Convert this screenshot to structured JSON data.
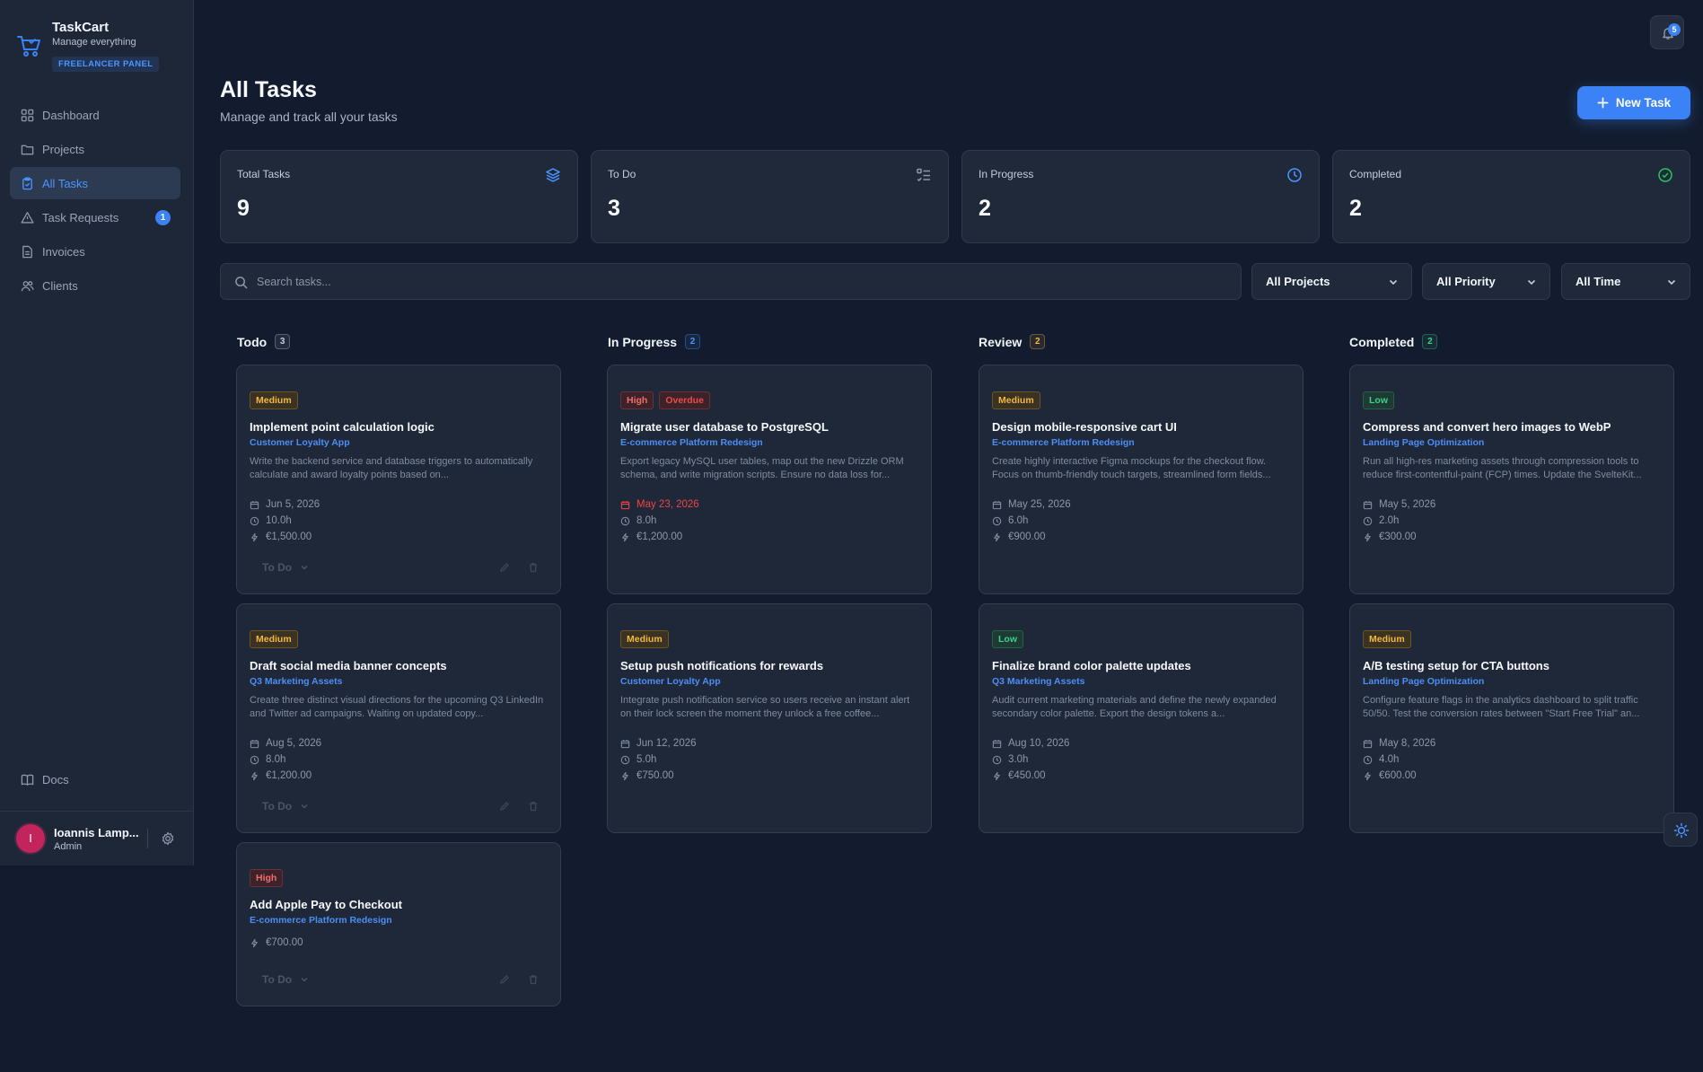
{
  "brand": {
    "name": "TaskCart",
    "tagline": "Manage everything",
    "panel": "FREELANCER PANEL"
  },
  "nav": {
    "items": [
      {
        "label": "Dashboard",
        "icon": "grid-icon"
      },
      {
        "label": "Projects",
        "icon": "folder-icon"
      },
      {
        "label": "All Tasks",
        "icon": "clipboard-icon",
        "active": true
      },
      {
        "label": "Task Requests",
        "icon": "alert-triangle-icon",
        "badge": "1"
      },
      {
        "label": "Invoices",
        "icon": "file-icon"
      },
      {
        "label": "Clients",
        "icon": "users-icon"
      }
    ],
    "docs": "Docs"
  },
  "user": {
    "name": "Ioannis Lamp...",
    "role": "Admin",
    "initial": "I"
  },
  "notifications": {
    "count": "5"
  },
  "header": {
    "title": "All Tasks",
    "subtitle": "Manage and track all your tasks",
    "new_task": "New Task"
  },
  "stats": [
    {
      "label": "Total Tasks",
      "value": "9",
      "icon": "layers-icon",
      "color": "#4d95ff"
    },
    {
      "label": "To Do",
      "value": "3",
      "icon": "list-todo-icon",
      "color": "#8c97aa"
    },
    {
      "label": "In Progress",
      "value": "2",
      "icon": "clock-icon",
      "color": "#4d95ff"
    },
    {
      "label": "Completed",
      "value": "2",
      "icon": "check-circle-icon",
      "color": "#22c55e"
    }
  ],
  "filters": {
    "search_placeholder": "Search tasks...",
    "projects": "All Projects",
    "priority": "All Priority",
    "time": "All Time"
  },
  "columns": [
    {
      "title": "Todo",
      "count": "3",
      "accent": "#c3ccd9"
    },
    {
      "title": "In Progress",
      "count": "2",
      "accent": "#4d95ff"
    },
    {
      "title": "Review",
      "count": "2",
      "accent": "#f5b83d"
    },
    {
      "title": "Completed",
      "count": "2",
      "accent": "#3ecf8e"
    }
  ],
  "cards": [
    {
      "col": 0,
      "row": 0,
      "priority": "Medium",
      "title": "Implement point calculation logic",
      "project": "Customer Loyalty App",
      "desc": "Write the backend service and database triggers to automatically calculate and award loyalty points based on...",
      "date": "Jun 5, 2026",
      "hours": "10.0h",
      "amount": "€1,500.00",
      "status": "To Do"
    },
    {
      "col": 0,
      "row": 1,
      "priority": "Medium",
      "title": "Draft social media banner concepts",
      "project": "Q3 Marketing Assets",
      "desc": "Create three distinct visual directions for the upcoming Q3 LinkedIn and Twitter ad campaigns. Waiting on updated copy...",
      "date": "Aug 5, 2026",
      "hours": "8.0h",
      "amount": "€1,200.00",
      "status": "To Do"
    },
    {
      "col": 0,
      "row": 2,
      "priority": "High",
      "title": "Add Apple Pay to Checkout",
      "project": "E-commerce Platform Redesign",
      "amount": "€700.00",
      "status": "To Do"
    },
    {
      "col": 1,
      "row": 0,
      "priority": "High",
      "overdue": "Overdue",
      "title": "Migrate user database to PostgreSQL",
      "project": "E-commerce Platform Redesign",
      "desc": "Export legacy MySQL user tables, map out the new Drizzle ORM schema, and write migration scripts. Ensure no data loss for...",
      "date": "May 23, 2026",
      "date_overdue": true,
      "hours": "8.0h",
      "amount": "€1,200.00"
    },
    {
      "col": 1,
      "row": 1,
      "priority": "Medium",
      "title": "Setup push notifications for rewards",
      "project": "Customer Loyalty App",
      "desc": "Integrate push notification service so users receive an instant alert on their lock screen the moment they unlock a free coffee...",
      "date": "Jun 12, 2026",
      "hours": "5.0h",
      "amount": "€750.00"
    },
    {
      "col": 2,
      "row": 0,
      "priority": "Medium",
      "title": "Design mobile-responsive cart UI",
      "project": "E-commerce Platform Redesign",
      "desc": "Create highly interactive Figma mockups for the checkout flow. Focus on thumb-friendly touch targets, streamlined form fields...",
      "date": "May 25, 2026",
      "hours": "6.0h",
      "amount": "€900.00"
    },
    {
      "col": 2,
      "row": 1,
      "priority": "Low",
      "title": "Finalize brand color palette updates",
      "project": "Q3 Marketing Assets",
      "desc": "Audit current marketing materials and define the newly expanded secondary color palette. Export the design tokens a...",
      "date": "Aug 10, 2026",
      "hours": "3.0h",
      "amount": "€450.00"
    },
    {
      "col": 3,
      "row": 0,
      "priority": "Low",
      "title": "Compress and convert hero images to WebP",
      "project": "Landing Page Optimization",
      "desc": "Run all high-res marketing assets through compression tools to reduce first-contentful-paint (FCP) times. Update the SvelteKit...",
      "date": "May 5, 2026",
      "hours": "2.0h",
      "amount": "€300.00"
    },
    {
      "col": 3,
      "row": 1,
      "priority": "Medium",
      "title": "A/B testing setup for CTA buttons",
      "project": "Landing Page Optimization",
      "desc": "Configure feature flags in the analytics dashboard to split traffic 50/50. Test the conversion rates between \"Start Free Trial\" an...",
      "date": "May 8, 2026",
      "hours": "4.0h",
      "amount": "€600.00"
    }
  ]
}
